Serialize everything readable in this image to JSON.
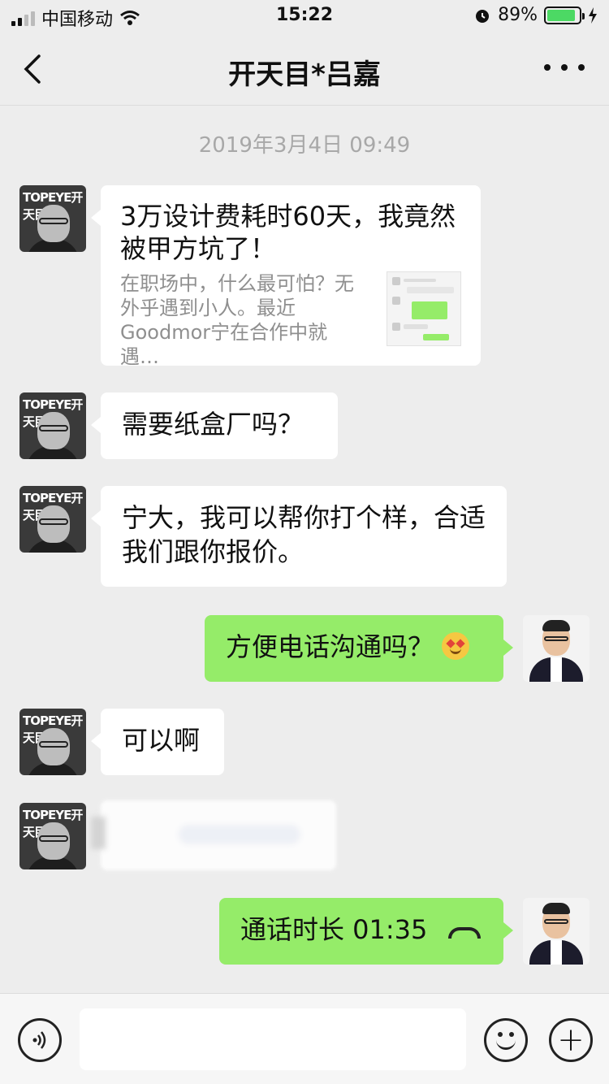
{
  "status_bar": {
    "carrier": "中国移动",
    "time": "15:22",
    "battery_percent": "89%",
    "battery_level": 0.89,
    "battery_color": "#4cd964"
  },
  "header": {
    "title": "开天目*吕嘉",
    "back_icon": "chevron-left-icon",
    "more_icon": "more-dots-icon"
  },
  "conversation": {
    "timestamp": "2019年3月4日 09:49",
    "other_avatar_text": "TOPEYE开天目",
    "link_card": {
      "title": "3万设计费耗时60天，我竟然被甲方坑了！",
      "description": "在职场中，什么最可怕？无外乎遇到小人。最近Goodmor宁在合作中就遇…"
    },
    "messages": {
      "m1": "需要纸盒厂吗？",
      "m2": "宁大，我可以帮你打个样，合适我们跟你报价。",
      "m3": "方便电话沟通吗？",
      "m4": "可以啊",
      "m6": "通话时长 01:35"
    },
    "bubble_color_out": "#95ec69",
    "bubble_color_in": "#ffffff"
  },
  "input_bar": {
    "voice_icon": "voice-icon",
    "emoji_icon": "emoji-icon",
    "plus_icon": "plus-icon",
    "plus_glyph": "+"
  }
}
